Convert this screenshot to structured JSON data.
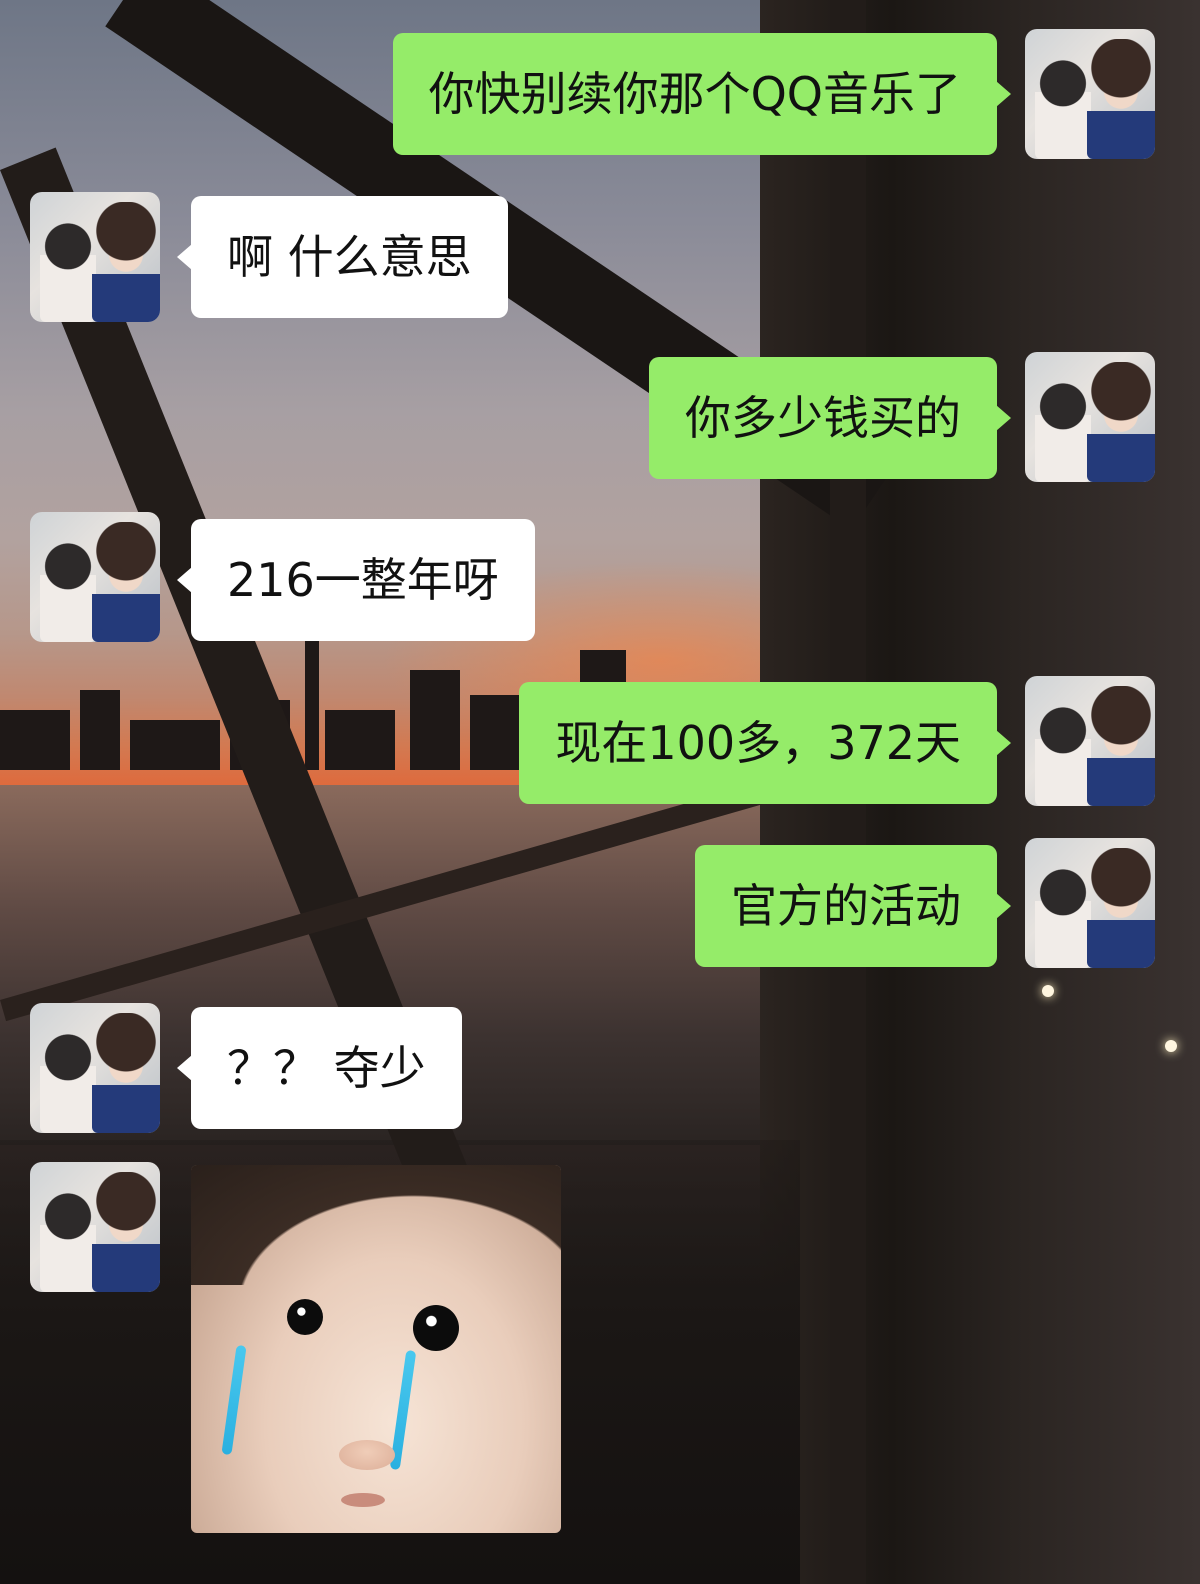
{
  "conversation": {
    "messages": [
      {
        "side": "right",
        "text": "你快别续你那个QQ音乐了"
      },
      {
        "side": "left",
        "text": "啊 什么意思"
      },
      {
        "side": "right",
        "text": "你多少钱买的"
      },
      {
        "side": "left",
        "text": "216一整年呀"
      },
      {
        "side": "right",
        "text": "现在100多，372天"
      },
      {
        "side": "right",
        "text": "官方的活动"
      },
      {
        "side": "left",
        "text": "？？ 夺少"
      },
      {
        "side": "left",
        "sticker": "crying-baby-sticker"
      }
    ]
  },
  "colors": {
    "sent_bubble": "#95ec69",
    "received_bubble": "#ffffff",
    "text": "#111111"
  }
}
